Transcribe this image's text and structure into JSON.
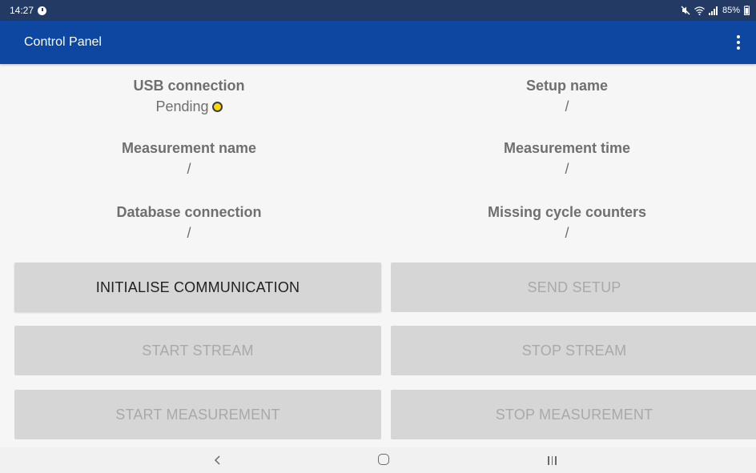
{
  "status_bar": {
    "time": "14:27",
    "battery": "85%"
  },
  "app_bar": {
    "title": "Control Panel"
  },
  "info": {
    "usb_connection": {
      "label": "USB connection",
      "value": "Pending"
    },
    "setup_name": {
      "label": "Setup name",
      "value": "/"
    },
    "measurement_name": {
      "label": "Measurement name",
      "value": "/"
    },
    "measurement_time": {
      "label": "Measurement time",
      "value": "/"
    },
    "database_connection": {
      "label": "Database connection",
      "value": "/"
    },
    "missing_cycle_counters": {
      "label": "Missing cycle counters",
      "value": "/"
    }
  },
  "buttons": {
    "initialise_communication": "INITIALISE COMMUNICATION",
    "send_setup": "SEND SETUP",
    "start_stream": "START STREAM",
    "stop_stream": "STOP STREAM",
    "start_measurement": "START MEASUREMENT",
    "stop_measurement": "STOP MEASUREMENT"
  },
  "colors": {
    "status_bar": "#233a64",
    "app_bar": "#0d47a1",
    "background": "#f6f6f6",
    "button": "#d6d6d6",
    "pending_indicator": "#ffd800"
  }
}
